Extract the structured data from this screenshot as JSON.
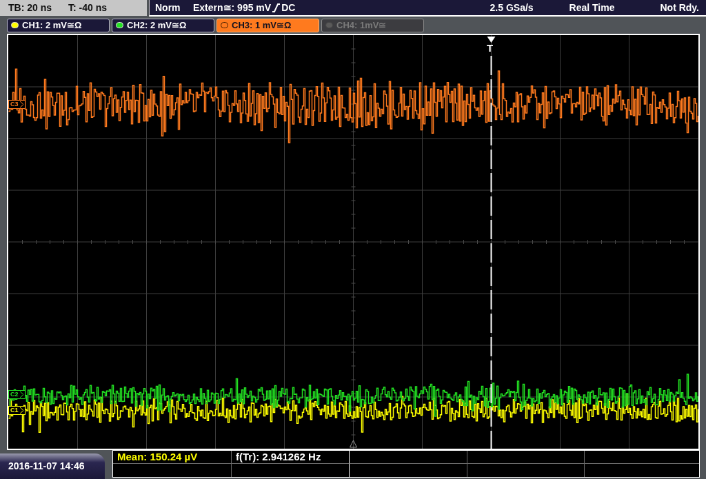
{
  "status_bar": {
    "timebase": "TB: 20 ns",
    "trigger_time": "T: -40 ns",
    "trigger_mode": "Norm",
    "trigger_source": "Extern≅: 995 mV",
    "trigger_rising": true,
    "trigger_coupling": "DC",
    "sample_rate": "2.5 GSa/s",
    "acquisition": "Real Time",
    "status": "Not Rdy."
  },
  "channels": [
    {
      "label": "CH1: 2 mV≅Ω",
      "color": "#ffff00",
      "selected": false,
      "enabled": true
    },
    {
      "label": "CH2: 2 mV≅Ω",
      "color": "#22e022",
      "selected": false,
      "enabled": true
    },
    {
      "label": "CH3: 1 mV≅Ω",
      "color": "#ff7a1e",
      "selected": true,
      "enabled": true
    },
    {
      "label": "CH4: 1mV≅",
      "color": "#5a5a5a",
      "selected": false,
      "enabled": false
    }
  ],
  "display": {
    "trigger_marker": "T",
    "markers": [
      {
        "label": "C3",
        "color": "#ff7a1e"
      },
      {
        "label": "C2",
        "color": "#22e022"
      },
      {
        "label": "C1",
        "color": "#ffff00"
      }
    ]
  },
  "measurements": [
    {
      "text": "Mean: 150.24 µV",
      "highlighted": true
    },
    {
      "text": "f(Tr): 2.941262 Hz",
      "highlighted": false
    }
  ],
  "date_time": "2016-11-07 14:46"
}
